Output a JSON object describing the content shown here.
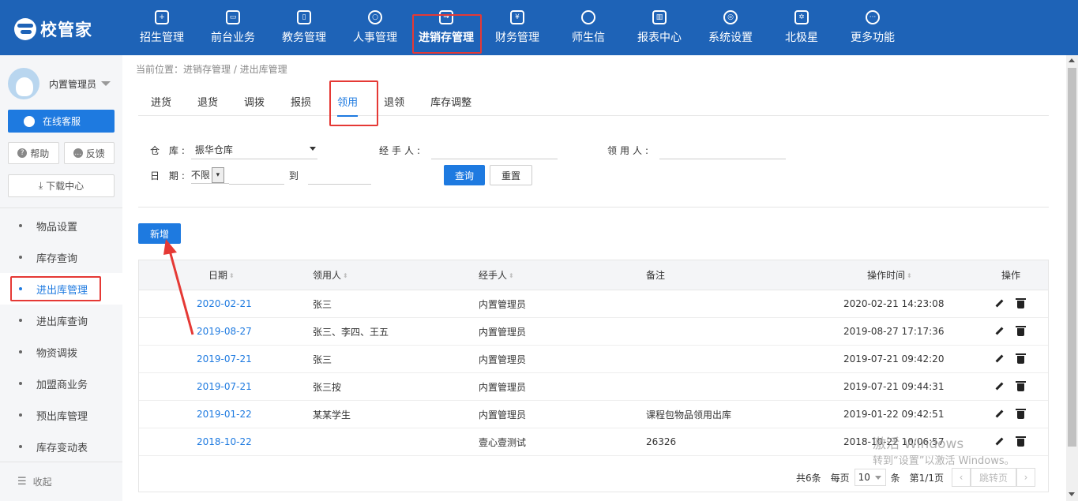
{
  "app": {
    "logo_text": "校管家"
  },
  "nav": {
    "items": [
      {
        "label": "招生管理",
        "icon": "person-add-icon",
        "glyph": "+"
      },
      {
        "label": "前台业务",
        "icon": "monitor-icon",
        "glyph": "▭"
      },
      {
        "label": "教务管理",
        "icon": "book-icon",
        "glyph": "▯"
      },
      {
        "label": "人事管理",
        "icon": "person-icon",
        "glyph": "○"
      },
      {
        "label": "进销存管理",
        "icon": "box-arrow-icon",
        "glyph": "→"
      },
      {
        "label": "财务管理",
        "icon": "yen-shield-icon",
        "glyph": "¥"
      },
      {
        "label": "师生信",
        "icon": "chat-icon",
        "glyph": " "
      },
      {
        "label": "报表中心",
        "icon": "report-icon",
        "glyph": "▥"
      },
      {
        "label": "系统设置",
        "icon": "gear-icon",
        "glyph": "◎"
      },
      {
        "label": "北极星",
        "icon": "star-icon",
        "glyph": "✡"
      },
      {
        "label": "更多功能",
        "icon": "more-icon",
        "glyph": "···"
      }
    ],
    "active_index": 4
  },
  "sidebar": {
    "user_name": "内置管理员",
    "service_label": "在线客服",
    "help_label": "帮助",
    "feedback_label": "反馈",
    "download_label": "下载中心",
    "menu": [
      {
        "label": "物品设置"
      },
      {
        "label": "库存查询"
      },
      {
        "label": "进出库管理"
      },
      {
        "label": "进出库查询"
      },
      {
        "label": "物资调拨"
      },
      {
        "label": "加盟商业务"
      },
      {
        "label": "预出库管理"
      },
      {
        "label": "库存变动表"
      }
    ],
    "active_index": 2,
    "collapse_label": "收起"
  },
  "main": {
    "breadcrumb": "当前位置：进销存管理 / 进出库管理",
    "tabs": [
      "进货",
      "退货",
      "调拨",
      "报损",
      "领用",
      "退领",
      "库存调整"
    ],
    "active_tab": 4,
    "filters": {
      "warehouse_label": "仓  库:",
      "warehouse_value": "振华仓库",
      "handler_label": "经手人:",
      "handler_value": "",
      "recipient_label": "领用人:",
      "recipient_value": "",
      "date_label": "日  期:",
      "date_mode": "不限",
      "to_label": "到",
      "query_label": "查询",
      "reset_label": "重置"
    },
    "new_label": "新增",
    "table": {
      "headers": {
        "date": "日期",
        "recipient": "领用人",
        "handler": "经手人",
        "note": "备注",
        "time": "操作时间",
        "op": "操作"
      },
      "rows": [
        {
          "date": "2020-02-21",
          "recipient": "张三",
          "handler": "内置管理员",
          "note": "",
          "time": "2020-02-21 14:23:08"
        },
        {
          "date": "2019-08-27",
          "recipient": "张三、李四、王五",
          "handler": "内置管理员",
          "note": "",
          "time": "2019-08-27 17:17:36"
        },
        {
          "date": "2019-07-21",
          "recipient": "张三",
          "handler": "内置管理员",
          "note": "",
          "time": "2019-07-21 09:42:20"
        },
        {
          "date": "2019-07-21",
          "recipient": "张三按",
          "handler": "内置管理员",
          "note": "",
          "time": "2019-07-21 09:44:31"
        },
        {
          "date": "2019-01-22",
          "recipient": "某某学生",
          "handler": "内置管理员",
          "note": "课程包物品领用出库",
          "time": "2019-01-22 09:42:51"
        },
        {
          "date": "2018-10-22",
          "recipient": "",
          "handler": "壹心壹测试",
          "note": "26326",
          "time": "2018-10-22 10:06:57"
        }
      ]
    },
    "pager": {
      "total": "共6条",
      "per_page_label": "每页",
      "per_page": "10",
      "unit": "条",
      "page_info": "第1/1页",
      "jump_label": "跳转页"
    }
  },
  "watermark": {
    "line1": "激活 Windows",
    "line2": "转到“设置”以激活 Windows。"
  },
  "colors": {
    "brand": "#1e63b7",
    "accent": "#1e7ae0",
    "highlight": "#e53935"
  }
}
